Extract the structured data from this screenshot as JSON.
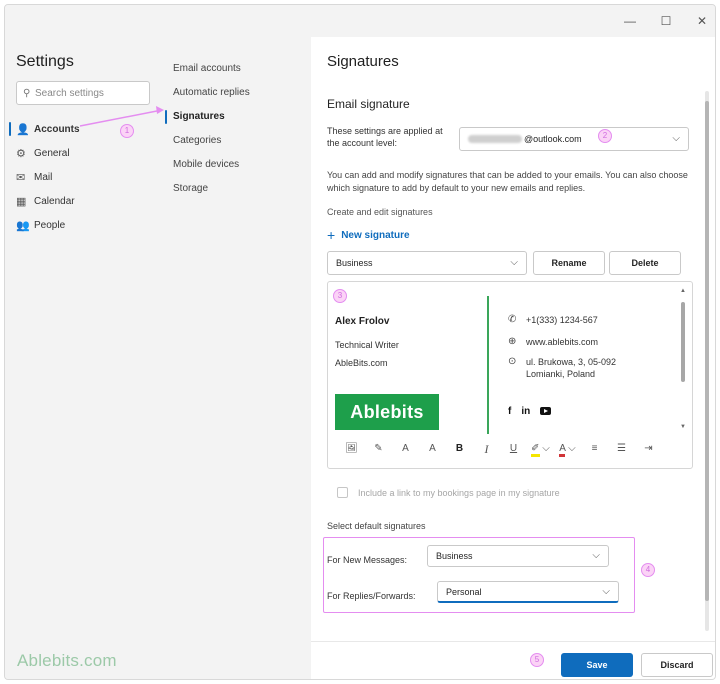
{
  "window": {
    "min_icon": "—",
    "max_icon": "☐",
    "close_icon": "✕"
  },
  "sidebar": {
    "title": "Settings",
    "search_placeholder": "Search settings",
    "items": [
      {
        "label": "Accounts",
        "icon": "person-icon",
        "glyph": "👤"
      },
      {
        "label": "General",
        "icon": "gear-icon",
        "glyph": "⚙"
      },
      {
        "label": "Mail",
        "icon": "mail-icon",
        "glyph": "✉"
      },
      {
        "label": "Calendar",
        "icon": "calendar-icon",
        "glyph": "▦"
      },
      {
        "label": "People",
        "icon": "people-icon",
        "glyph": "👥"
      }
    ],
    "brand": "Ablebits.com"
  },
  "subnav": {
    "items": [
      "Email accounts",
      "Automatic replies",
      "Signatures",
      "Categories",
      "Mobile devices",
      "Storage"
    ]
  },
  "pane": {
    "title": "Signatures",
    "section_title": "Email signature",
    "applied_label": "These settings are applied at the account level:",
    "account_domain": "@outlook.com",
    "description": "You can add and modify signatures that can be added to your emails. You can also choose which signature to add by default to your new emails and replies.",
    "create_label": "Create and edit signatures",
    "new_signature": "New signature",
    "selected_signature": "Business",
    "rename": "Rename",
    "delete": "Delete"
  },
  "signature": {
    "name": "Alex Frolov",
    "role": "Technical Writer",
    "company": "AbleBits.com",
    "logo_text": "Ablebits",
    "phone": "+1(333) 1234-567",
    "website": "www.ablebits.com",
    "address_line1": "ul. Brukowa, 3, 05-092",
    "address_line2": "Lomianki, Poland",
    "facebook": "f",
    "linkedin": "in"
  },
  "toolbar": {
    "image": "🖼",
    "paint": "✎",
    "font_size_down": "A",
    "font_size_up": "A",
    "bold": "B",
    "italic": "I",
    "underline": "U",
    "highlight": "✐",
    "font_color": "A",
    "align": "≡",
    "bullets": "☰",
    "indent": "⇥"
  },
  "booking_label": "Include a link to my bookings page in my signature",
  "defaults": {
    "label": "Select default signatures",
    "new_label": "For New Messages:",
    "new_value": "Business",
    "reply_label": "For Replies/Forwards:",
    "reply_value": "Personal"
  },
  "footer": {
    "save": "Save",
    "discard": "Discard"
  },
  "markers": [
    "1",
    "2",
    "3",
    "4",
    "5"
  ],
  "colors": {
    "accent": "#0f6cbd",
    "brand_green": "#1e9f4b",
    "annotation_pink": "#e48df0"
  }
}
